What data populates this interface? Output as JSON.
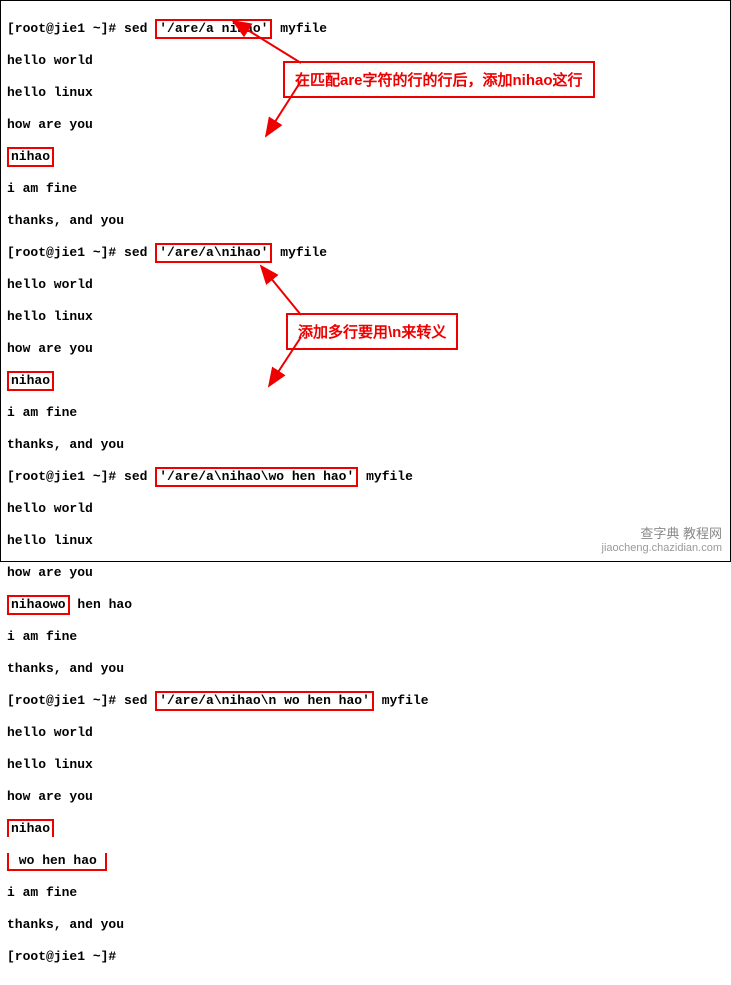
{
  "prompt": "[root@jie1 ~]# ",
  "cmd": "sed ",
  "file": " myfile",
  "args": {
    "a1": "'/are/a nihao'",
    "a2": "'/are/a\\nihao'",
    "a3": "'/are/a\\nihao\\wo hen hao'",
    "a4": "'/are/a\\nihao\\n wo hen hao'"
  },
  "out": {
    "hw": "hello world",
    "hl": "hello linux",
    "hay": "how are you",
    "nihao": "nihao",
    "nihaowo": "nihaowo",
    "henhao": " hen hao",
    "wohenhao": " wo hen hao",
    "iaf": "i am fine",
    "tay": "thanks, and you"
  },
  "callouts": {
    "c1": "在匹配are字符的行的行后，添加nihao这行",
    "c2": "添加多行要用\\n来转义"
  },
  "watermark": {
    "main": "查字典  教程网",
    "sub": "jiaocheng.chazidian.com"
  }
}
